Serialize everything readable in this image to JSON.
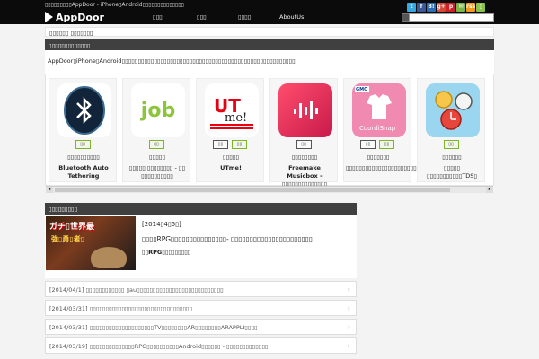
{
  "header": {
    "tagline": "▯▯▯▯▯▯▯▯▯AppDoor - iPhone▯Android▯▯▯▯▯▯▯▯▯▯▯▯▯▯",
    "logo": "AppDoor",
    "nav": [
      "▯▯▯",
      "▯▯▯",
      "▯▯▯▯",
      "AboutUs."
    ],
    "social": [
      "t",
      "f",
      "B!",
      "g+",
      "p",
      "✉",
      "rss",
      "▯"
    ]
  },
  "breadcrumb": {
    "home": "▯▯▯▯▯▯",
    "current": "▯▯▯▯▯▯▯"
  },
  "section1": {
    "title": "▯▯▯▯▯▯▯▯▯▯▯▯▯"
  },
  "intro": "AppDoor▯iPhone▯Android▯▯▯▯▯▯▯▯▯▯▯▯▯▯▯▯▯▯▯▯▯▯▯▯▯▯▯▯▯▯▯▯▯▯▯▯▯▯▯▯▯▯▯▯▯▯▯▯▯▯▯▯▯▯",
  "apps": [
    {
      "tags": [
        "▯▯"
      ],
      "category": "▯▯▯▯▯▯▯▯▯▯",
      "name": "Bluetooth Auto Tethering",
      "icon": "bluetooth-icon"
    },
    {
      "tags": [
        "▯▯"
      ],
      "category": "▯▯▯▯▯",
      "name": "▯▯▯▯▯ ▯▯▯▯▯▯▯▯ - ▯▯ ▯▯▯▯▯▯▯▯▯▯",
      "icon": "job-icon"
    },
    {
      "tags": [
        "▯▯",
        "▯▯"
      ],
      "category": "▯▯▯▯▯",
      "name": "UTme!",
      "icon": "utme-icon"
    },
    {
      "tags": [
        "▯▯"
      ],
      "category": "▯▯▯▯▯▯▯▯",
      "name": "Freemake Musicbox - ▯▯▯▯▯▯▯▯▯▯▯▯▯▯",
      "icon": "musicbox-icon"
    },
    {
      "tags": [
        "▯▯",
        "▯▯"
      ],
      "category": "▯▯▯▯▯▯▯",
      "name": "▯▯▯▯▯▯▯▯▯▯▯▯▯▯▯▯▯▯▯▯▯▯▯▯WEAR",
      "icon": "coordisnap-icon"
    },
    {
      "tags": [
        "▯▯"
      ],
      "category": "▯▯▯▯▯▯",
      "name": "▯▯▯▯▯ ▯▯▯▯▯▯▯▯▯▯▯TDS▯",
      "icon": "clock-icon"
    }
  ],
  "section2": {
    "title": "▯▯▯▯▯▯▯▯▯"
  },
  "featured": {
    "date": "[2014▯4▯5▯]",
    "title": "▯▯▯▯RPG▯▯▯▯▯▯▯▯▯▯▯▯▯▯▯- ▯▯▯▯▯▯▯▯▯▯▯▯▯▯▯▯▯▯▯▯▯▯",
    "category": "▯▯RPG▯▯▯▯▯▯▯▯▯",
    "img_text1": "ガチ▯世界最",
    "img_text2": "強▯勇▯者▯"
  },
  "list": [
    {
      "date": "[2014/04/1]",
      "text": "▯▯▯▯▯▯▯▯▯▯▯▯ ▯au▯▯▯▯▯▯▯▯▯▯▯▯▯▯▯▯▯▯▯▯▯▯▯▯▯▯▯"
    },
    {
      "date": "[2014/03/31]",
      "text": "▯▯▯▯▯▯▯▯▯▯▯▯▯▯▯▯▯▯▯▯▯▯▯▯▯▯▯▯▯▯▯▯"
    },
    {
      "date": "[2014/03/31]",
      "text": "▯▯▯▯▯▯▯▯▯▯▯▯▯▯▯▯▯▯▯▯TV▯▯▯▯▯▯▯▯AR▯▯▯▯▯▯▯▯ARAPPLI▯▯▯▯"
    },
    {
      "date": "[2014/03/19]",
      "text": "▯▯▯▯▯▯▯▯▯▯▯▯▯▯RPG▯▯▯▯▯▯▯▯▯▯Android▯▯▯▯▯▯ - ▯▯▯▯▯▯▯▯▯▯▯▯▯"
    }
  ]
}
